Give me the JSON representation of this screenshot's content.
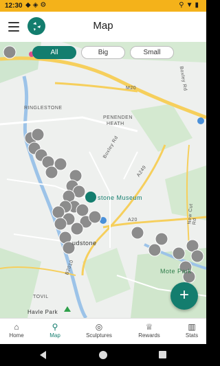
{
  "status_bar": {
    "time": "12:30"
  },
  "header": {
    "title": "Map"
  },
  "filters": [
    "All",
    "Big",
    "Small"
  ],
  "map": {
    "labels": {
      "ringlestone": "RINGLESTONE",
      "penenden": "PENENDEN",
      "heath": "HEATH",
      "boxley_rd": "Boxley Rd",
      "museum": "stone Museum",
      "maidstone": "udstone",
      "mote_park": "Mote Park",
      "tovil": "TOVIL",
      "havle_park": "Havle Park",
      "m20": "M20",
      "a249": "A249",
      "a20": "A20",
      "b2010": "B2010",
      "new_cut_rd": "New Cut Rd",
      "boxley_rd2": "Boxley Rd"
    }
  },
  "fab": {
    "label": "+"
  },
  "nav": [
    {
      "label": "Home",
      "icon": "home-icon"
    },
    {
      "label": "Map",
      "icon": "map-pin-icon"
    },
    {
      "label": "Sculptures",
      "icon": "sculpture-icon"
    },
    {
      "label": "Rewards",
      "icon": "trophy-icon"
    },
    {
      "label": "Stats",
      "icon": "bar-chart-icon"
    }
  ],
  "colors": {
    "primary": "#137d6e",
    "status": "#f4b21a",
    "marker": "#8c8c8c"
  }
}
